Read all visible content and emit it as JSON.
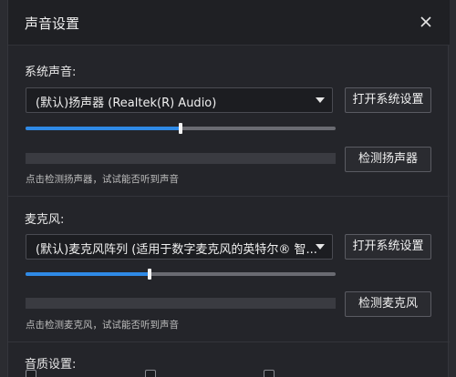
{
  "dialog": {
    "title": "声音设置"
  },
  "system_sound": {
    "label": "系统声音:",
    "device": "(默认)扬声器 (Realtek(R) Audio)",
    "open_settings_label": "打开系统设置",
    "volume_level": 0.5,
    "test_button_label": "检测扬声器",
    "hint": "点击检测扬声器，试试能否听到声音"
  },
  "microphone": {
    "label": "麦克风:",
    "device": "(默认)麦克风阵列 (适用于数字麦克风的英特尔® 智...",
    "open_settings_label": "打开系统设置",
    "volume_level": 0.4,
    "test_button_label": "检测麦克风",
    "hint": "点击检测麦克风，试试能否听到声音"
  },
  "audio_quality": {
    "label": "音质设置:"
  },
  "colors": {
    "accent": "#2f8ae6",
    "dialog_bg": "#24252a",
    "titlebar_bg": "#1f2024"
  }
}
